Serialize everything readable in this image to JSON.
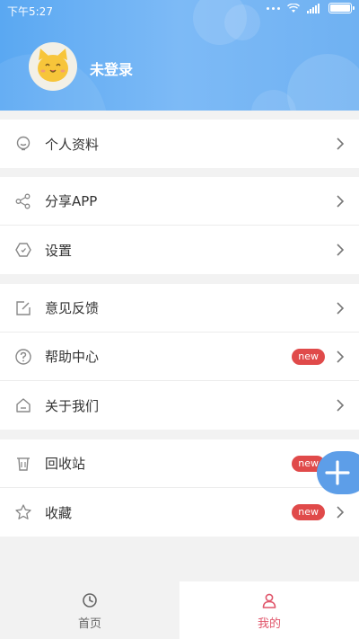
{
  "status": {
    "time": "下午5:27"
  },
  "profile": {
    "login_text": "未登录"
  },
  "menu": {
    "group1": [
      {
        "label": "个人资料",
        "icon": "profile-icon"
      }
    ],
    "group2": [
      {
        "label": "分享APP",
        "icon": "share-icon"
      },
      {
        "label": "设置",
        "icon": "settings-icon"
      }
    ],
    "group3": [
      {
        "label": "意见反馈",
        "icon": "feedback-icon"
      },
      {
        "label": "帮助中心",
        "icon": "help-icon",
        "badge": "new"
      },
      {
        "label": "关于我们",
        "icon": "about-icon"
      }
    ],
    "group4": [
      {
        "label": "回收站",
        "icon": "trash-icon",
        "badge": "new"
      },
      {
        "label": "收藏",
        "icon": "star-icon",
        "badge": "new"
      }
    ]
  },
  "tabs": [
    {
      "label": "首页",
      "icon": "clock-icon",
      "active": false
    },
    {
      "label": "我的",
      "icon": "user-icon",
      "active": true
    }
  ],
  "colors": {
    "header": "#6fb1f2",
    "badge": "#e04a4a",
    "active_tab": "#e0566b",
    "fab": "#5d9ee8"
  }
}
